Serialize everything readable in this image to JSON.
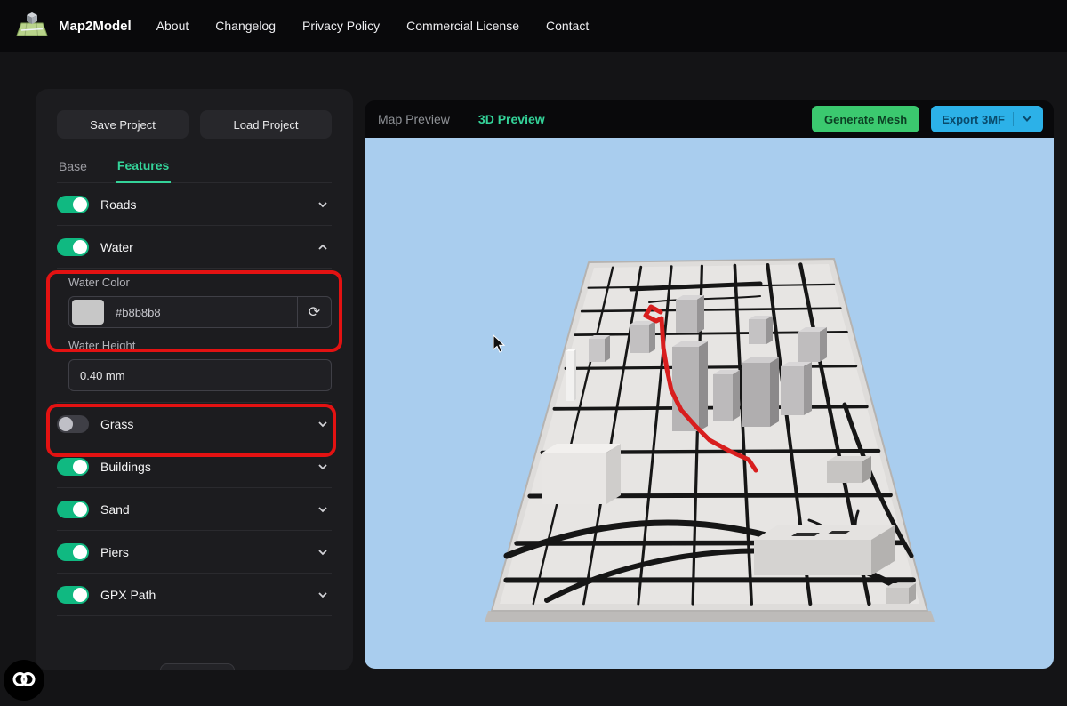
{
  "navbar": {
    "brand": "Map2Model",
    "links": [
      "About",
      "Changelog",
      "Privacy Policy",
      "Commercial License",
      "Contact"
    ]
  },
  "sidebar": {
    "save_button": "Save Project",
    "load_button": "Load Project",
    "tabs": {
      "base": "Base",
      "features": "Features"
    },
    "active_tab": "Features",
    "features": [
      {
        "label": "Roads",
        "enabled": true,
        "expanded": false
      },
      {
        "label": "Water",
        "enabled": true,
        "expanded": true
      },
      {
        "label": "Grass",
        "enabled": false,
        "expanded": false
      },
      {
        "label": "Buildings",
        "enabled": true,
        "expanded": false
      },
      {
        "label": "Sand",
        "enabled": true,
        "expanded": false
      },
      {
        "label": "Piers",
        "enabled": true,
        "expanded": false
      },
      {
        "label": "GPX Path",
        "enabled": true,
        "expanded": false
      }
    ],
    "water_settings": {
      "color_label": "Water Color",
      "color_value": "#b8b8b8",
      "height_label": "Water Height",
      "height_value": "0.40 mm"
    }
  },
  "preview": {
    "tab_map": "Map Preview",
    "tab_3d": "3D Preview",
    "active_tab": "3D Preview",
    "generate_button": "Generate Mesh",
    "export_button": "Export 3MF"
  },
  "icons": {
    "refresh": "⟳"
  },
  "colors": {
    "accent_green": "#10b981",
    "active_tab_green": "#34d399",
    "generate_button_green": "#3bc96f",
    "export_button_blue": "#2cb1e8",
    "annotation_red": "#e31212",
    "preview_background": "#a9cdee",
    "gpx_path_red": "#d81e1e",
    "water_swatch": "#b8b8b8"
  }
}
